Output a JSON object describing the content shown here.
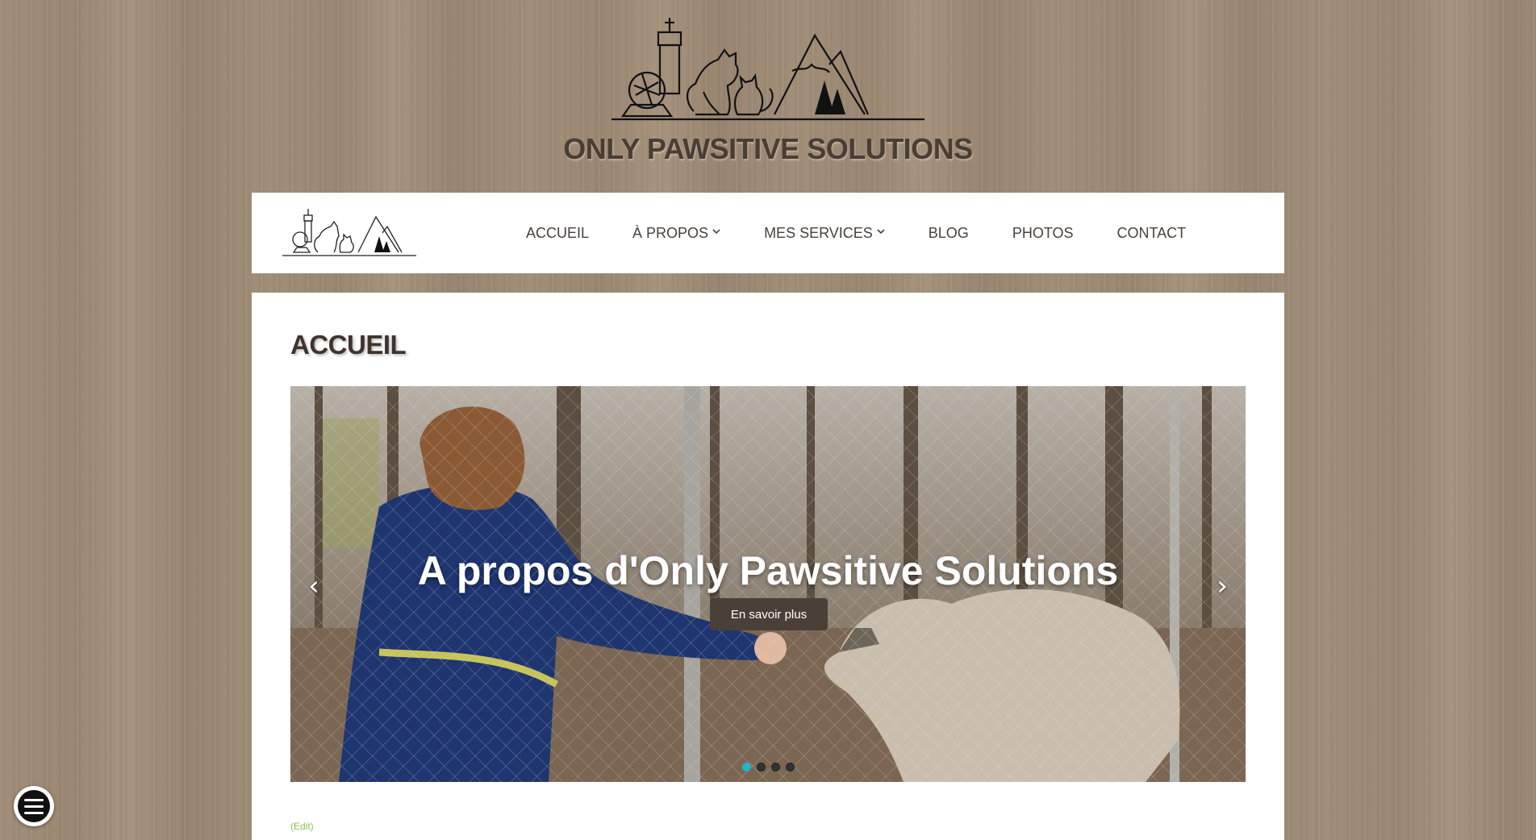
{
  "header": {
    "site_title": "ONLY PAWSITIVE SOLUTIONS",
    "logo_icon": "logo-tower-dog-cat-mountains"
  },
  "nav": {
    "logo_icon": "logo-tower-dog-cat-mountains",
    "items": [
      {
        "label": "ACCUEIL",
        "has_dropdown": false
      },
      {
        "label": "À PROPOS",
        "has_dropdown": true
      },
      {
        "label": "MES SERVICES",
        "has_dropdown": true
      },
      {
        "label": "BLOG",
        "has_dropdown": false
      },
      {
        "label": "PHOTOS",
        "has_dropdown": false
      },
      {
        "label": "CONTACT",
        "has_dropdown": false
      }
    ],
    "dropdown_icon": "chevron-down-icon"
  },
  "main": {
    "page_title": "ACCUEIL",
    "slider": {
      "caption": "A propos d'Only Pawsitive Solutions",
      "button_label": "En savoir plus",
      "prev_icon": "‹",
      "next_icon": "›",
      "slide_count": 4,
      "active_slide": 1
    },
    "edit_link": "(Edit)"
  },
  "colors": {
    "background_wood": "#9c8a74",
    "panel": "#ffffff",
    "title_text": "#4a3d33",
    "button": "#4b4037",
    "active_dot": "#1fb6c9",
    "edit_link": "#8bc34a"
  },
  "floating_menu": {
    "icon": "hamburger-menu-icon"
  }
}
